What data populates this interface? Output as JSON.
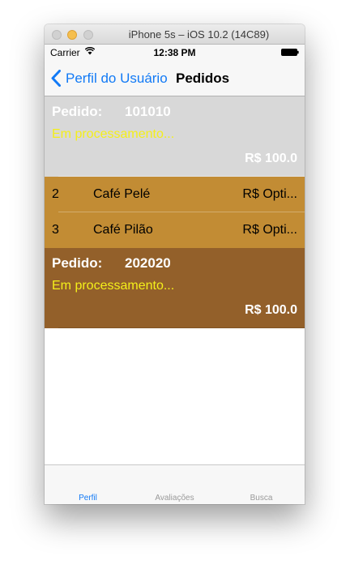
{
  "window": {
    "title": "iPhone 5s – iOS 10.2 (14C89)"
  },
  "status_bar": {
    "carrier": "Carrier",
    "time": "12:38 PM"
  },
  "navbar": {
    "back_label": "Perfil do Usuário",
    "title": "Pedidos"
  },
  "orders": [
    {
      "label": "Pedido:",
      "number": "101010",
      "status": "Em processamento...",
      "total": "R$ 100.0",
      "items": [
        {
          "qty": "2",
          "name": "Café Pelé",
          "price": "R$ Opti..."
        },
        {
          "qty": "3",
          "name": "Café Pilão",
          "price": "R$ Opti..."
        }
      ]
    },
    {
      "label": "Pedido:",
      "number": "202020",
      "status": "Em processamento...",
      "total": "R$ 100.0"
    }
  ],
  "tabbar": {
    "tabs": [
      {
        "label": "Perfil"
      },
      {
        "label": "Avaliações"
      },
      {
        "label": "Busca"
      }
    ]
  },
  "colors": {
    "accent": "#127af6",
    "order_1_bg": "#d8d8d8",
    "order_2_bg": "#93602a",
    "item_bg": "#c28c34",
    "status_text": "#f4ef1a"
  }
}
